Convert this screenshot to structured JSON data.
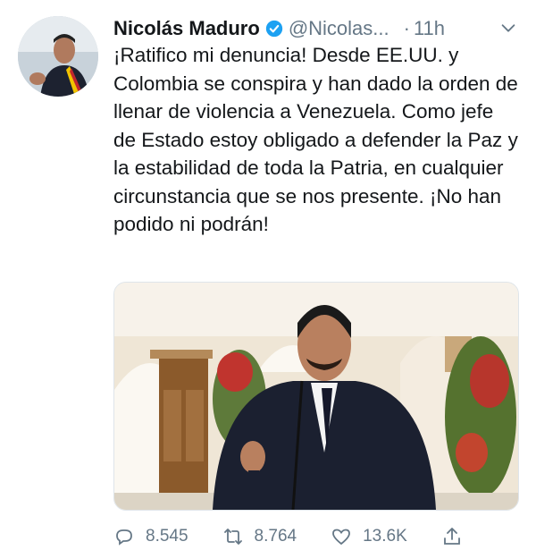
{
  "tweet": {
    "author_name": "Nicolás Maduro",
    "handle": "@Nicolas...",
    "dot": "·",
    "time": "11h",
    "text": "¡Ratifico mi denuncia! Desde EE.UU. y Colombia se conspira y han dado la orden de llenar de violencia a Venezuela. Como jefe de Estado estoy obligado a defender la Paz y la estabilidad de toda la Patria, en cualquier circunstancia que se nos presente. ¡No han podido ni podrán!",
    "actions": {
      "reply_count": "8.545",
      "retweet_count": "8.764",
      "like_count": "13.6K"
    }
  },
  "icons": [
    "verified-badge-icon",
    "chevron-down-icon",
    "reply-icon",
    "retweet-icon",
    "like-icon",
    "share-icon"
  ],
  "colors": {
    "verified": "#1da1f2",
    "secondary_text": "#657786",
    "primary_text": "#14171a"
  }
}
